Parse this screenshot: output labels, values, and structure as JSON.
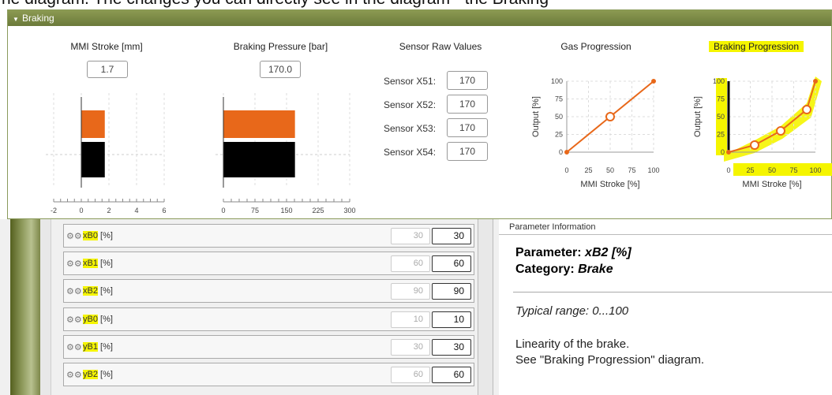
{
  "caption": "he diagram. The changes you can directly see in the diagram - the Braking",
  "panel": {
    "title": "Braking"
  },
  "sections": {
    "mmi": {
      "title": "MMI Stroke [mm]",
      "value": "1.7",
      "ticks": [
        "-2",
        "0",
        "2",
        "4",
        "6"
      ],
      "xlim": [
        -2,
        6
      ],
      "reading": 1.7
    },
    "pressure": {
      "title": "Braking Pressure [bar]",
      "value": "170.0",
      "ticks": [
        "0",
        "75",
        "150",
        "225",
        "300"
      ],
      "xlim": [
        0,
        300
      ],
      "reading": 170
    },
    "sensors": {
      "title": "Sensor Raw Values",
      "items": [
        {
          "label": "Sensor X51:",
          "value": "170"
        },
        {
          "label": "Sensor X52:",
          "value": "170"
        },
        {
          "label": "Sensor X53:",
          "value": "170"
        },
        {
          "label": "Sensor X54:",
          "value": "170"
        }
      ]
    },
    "gas": {
      "title": "Gas Progression",
      "ylabel": "Output [%]",
      "xlabel": "MMI Stroke [%]",
      "yticks": [
        "0",
        "25",
        "50",
        "75",
        "100"
      ],
      "xticks": [
        "0",
        "25",
        "50",
        "75",
        "100"
      ]
    },
    "brake": {
      "title": "Braking Progression",
      "ylabel": "Output [%]",
      "xlabel": "MMI Stroke [%]",
      "yticks": [
        "0",
        "25",
        "50",
        "75",
        "100"
      ],
      "xticks": [
        "0",
        "25",
        "50",
        "75",
        "100"
      ]
    }
  },
  "chart_data": [
    {
      "type": "bar",
      "title": "MMI Stroke [mm]",
      "values": [
        1.7
      ],
      "xlim": [
        -2,
        6
      ]
    },
    {
      "type": "bar",
      "title": "Braking Pressure [bar]",
      "values": [
        170
      ],
      "xlim": [
        0,
        300
      ]
    },
    {
      "type": "line",
      "title": "Gas Progression",
      "xlabel": "MMI Stroke [%]",
      "ylabel": "Output [%]",
      "x": [
        0,
        50,
        100
      ],
      "y": [
        0,
        50,
        100
      ],
      "xlim": [
        0,
        100
      ],
      "ylim": [
        0,
        100
      ]
    },
    {
      "type": "line",
      "title": "Braking Progression",
      "xlabel": "MMI Stroke [%]",
      "ylabel": "Output [%]",
      "x": [
        0,
        30,
        60,
        90,
        100
      ],
      "y": [
        0,
        10,
        30,
        60,
        100
      ],
      "xlim": [
        0,
        100
      ],
      "ylim": [
        0,
        100
      ]
    }
  ],
  "params": {
    "rows": [
      {
        "name": "xB0",
        "unit": "[%]",
        "default": "30",
        "value": "30"
      },
      {
        "name": "xB1",
        "unit": "[%]",
        "default": "60",
        "value": "60"
      },
      {
        "name": "xB2",
        "unit": "[%]",
        "default": "90",
        "value": "90"
      },
      {
        "name": "yB0",
        "unit": "[%]",
        "default": "10",
        "value": "10"
      },
      {
        "name": "yB1",
        "unit": "[%]",
        "default": "30",
        "value": "30"
      },
      {
        "name": "yB2",
        "unit": "[%]",
        "default": "60",
        "value": "60"
      }
    ]
  },
  "info": {
    "header": "Parameter Information",
    "param_label": "Parameter: ",
    "param_value": "xB2 [%]",
    "cat_label": "Category: ",
    "cat_value": "Brake",
    "range": "Typical range: 0...100",
    "desc1": "Linearity of the brake.",
    "desc2": "See \"Braking Progression\" diagram."
  },
  "colors": {
    "accent": "#e8681a",
    "bar_dark": "#000000",
    "header": "#7a8845",
    "highlight": "#f5f500"
  }
}
